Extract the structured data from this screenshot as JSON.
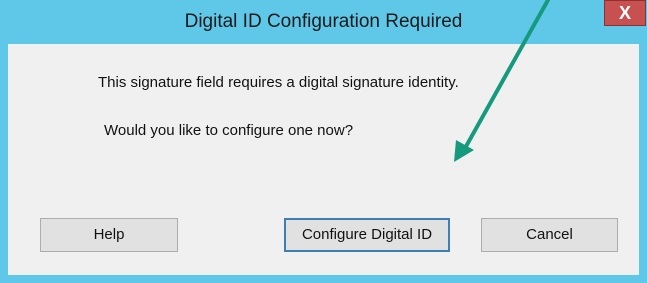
{
  "window": {
    "title": "Digital ID Configuration Required",
    "close_label": "X"
  },
  "message": {
    "line1": "This signature field requires a digital signature identity.",
    "line2": "Would you like to configure one now?"
  },
  "buttons": {
    "help": "Help",
    "configure": "Configure Digital ID",
    "cancel": "Cancel"
  },
  "colors": {
    "titlebar": "#5fc8e8",
    "close_button": "#c75050",
    "annotation_arrow": "#159a7e"
  }
}
